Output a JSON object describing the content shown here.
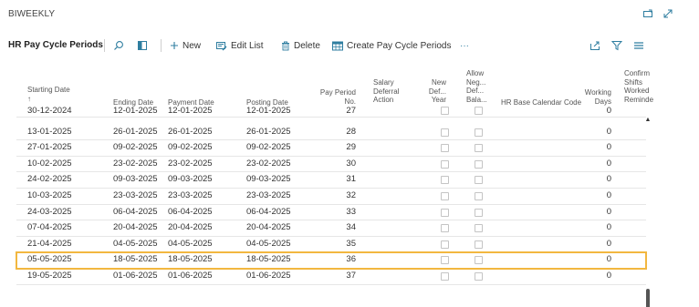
{
  "window": {
    "title": "BIWEEKLY"
  },
  "actions": {
    "page_title": "HR Pay Cycle Periods",
    "new_label": "New",
    "edit_list_label": "Edit List",
    "delete_label": "Delete",
    "create_label": "Create Pay Cycle Periods",
    "more_label": "···"
  },
  "columns": {
    "starting_date": "Starting Date",
    "sort_arrow": "↑",
    "ending_date": "Ending Date",
    "payment_date": "Payment Date",
    "posting_date": "Posting Date",
    "pay_period_l1": "Pay Period",
    "pay_period_l2": "No.",
    "salary_l1": "Salary",
    "salary_l2": "Deferral",
    "salary_l3": "Action",
    "newdef_l1": "New",
    "newdef_l2": "Def...",
    "newdef_l3": "Year",
    "allow_l1": "Allow",
    "allow_l2": "Neg...",
    "allow_l3": "Def...",
    "allow_l4": "Bala...",
    "calendar_l1": "HR Base",
    "calendar_l2": "Calendar Code",
    "working_l1": "Working",
    "working_l2": "Days",
    "confirm_l1": "Confirm",
    "confirm_l2": "Shifts",
    "confirm_l3": "Worked",
    "confirm_l4": "Reminde"
  },
  "rows": [
    {
      "start": "30-12-2024",
      "end": "12-01-2025",
      "payment": "12-01-2025",
      "posting": "12-01-2025",
      "no": "27",
      "days": "0"
    },
    {
      "start": "13-01-2025",
      "end": "26-01-2025",
      "payment": "26-01-2025",
      "posting": "26-01-2025",
      "no": "28",
      "days": "0"
    },
    {
      "start": "27-01-2025",
      "end": "09-02-2025",
      "payment": "09-02-2025",
      "posting": "09-02-2025",
      "no": "29",
      "days": "0"
    },
    {
      "start": "10-02-2025",
      "end": "23-02-2025",
      "payment": "23-02-2025",
      "posting": "23-02-2025",
      "no": "30",
      "days": "0"
    },
    {
      "start": "24-02-2025",
      "end": "09-03-2025",
      "payment": "09-03-2025",
      "posting": "09-03-2025",
      "no": "31",
      "days": "0"
    },
    {
      "start": "10-03-2025",
      "end": "23-03-2025",
      "payment": "23-03-2025",
      "posting": "23-03-2025",
      "no": "32",
      "days": "0"
    },
    {
      "start": "24-03-2025",
      "end": "06-04-2025",
      "payment": "06-04-2025",
      "posting": "06-04-2025",
      "no": "33",
      "days": "0"
    },
    {
      "start": "07-04-2025",
      "end": "20-04-2025",
      "payment": "20-04-2025",
      "posting": "20-04-2025",
      "no": "34",
      "days": "0"
    },
    {
      "start": "21-04-2025",
      "end": "04-05-2025",
      "payment": "04-05-2025",
      "posting": "04-05-2025",
      "no": "35",
      "days": "0"
    },
    {
      "start": "05-05-2025",
      "end": "18-05-2025",
      "payment": "18-05-2025",
      "posting": "18-05-2025",
      "no": "36",
      "days": "0"
    },
    {
      "start": "19-05-2025",
      "end": "01-06-2025",
      "payment": "01-06-2025",
      "posting": "01-06-2025",
      "no": "37",
      "days": "0"
    }
  ],
  "selected_row": 9,
  "colors": {
    "accent": "#2f7ea0",
    "selection": "#f2b740"
  },
  "icons": {
    "collapse": "collapse-icon",
    "expand": "expand-icon",
    "search": "search-icon",
    "filter_pane": "filter-pane-icon",
    "new": "plus-icon",
    "edit_list": "edit-list-icon",
    "delete": "trash-icon",
    "create": "table-icon",
    "share": "share-icon",
    "filter": "filter-icon",
    "list_view": "list-view-icon"
  }
}
